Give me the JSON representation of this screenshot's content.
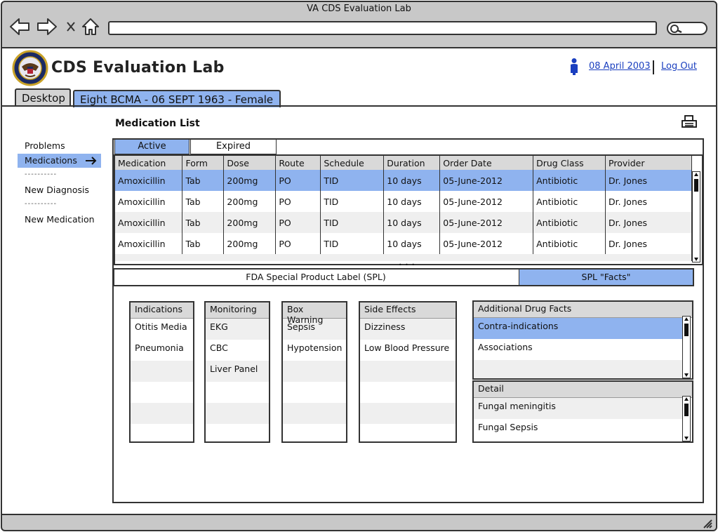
{
  "window": {
    "title": "VA CDS Evaluation Lab"
  },
  "header": {
    "app_name": "CDS Evaluation Lab",
    "date_link": "08 April 2003",
    "logout_label": "Log Out"
  },
  "tabs": [
    {
      "label": "Desktop"
    },
    {
      "label": "Eight BCMA - 06 SEPT 1963 - Female"
    }
  ],
  "sidebar": {
    "items": [
      {
        "label": "Problems"
      },
      {
        "label": "Medications"
      },
      {
        "label": "----------"
      },
      {
        "label": "New Diagnosis"
      },
      {
        "label": "----------"
      },
      {
        "label": "New Medication"
      }
    ]
  },
  "main": {
    "title": "Medication List",
    "subtabs": [
      {
        "label": "Active"
      },
      {
        "label": "Expired"
      }
    ],
    "columns": [
      "Medication",
      "Form",
      "Dose",
      "Route",
      "Schedule",
      "Duration",
      "Order Date",
      "Drug Class",
      "Provider"
    ],
    "rows": [
      [
        "Amoxicillin",
        "Tab",
        "200mg",
        "PO",
        "TID",
        "10 days",
        "05-June-2012",
        "Antibiotic",
        "Dr. Jones"
      ],
      [
        "Amoxicillin",
        "Tab",
        "200mg",
        "PO",
        "TID",
        "10 days",
        "05-June-2012",
        "Antibiotic",
        "Dr. Jones"
      ],
      [
        "Amoxicillin",
        "Tab",
        "200mg",
        "PO",
        "TID",
        "10 days",
        "05-June-2012",
        "Antibiotic",
        "Dr. Jones"
      ],
      [
        "Amoxicillin",
        "Tab",
        "200mg",
        "PO",
        "TID",
        "10 days",
        "05-June-2012",
        "Antibiotic",
        "Dr. Jones"
      ]
    ],
    "splitter": "• • •",
    "spl_tabs": [
      {
        "label": "FDA Special Product Label (SPL)"
      },
      {
        "label": "SPL \"Facts\""
      }
    ]
  },
  "facts": {
    "indications": {
      "header": "Indications",
      "items": [
        "Otitis Media",
        "Pneumonia"
      ]
    },
    "monitoring": {
      "header": "Monitoring",
      "items": [
        "EKG",
        "CBC",
        "Liver Panel"
      ]
    },
    "box_warning": {
      "header": "Box Warning",
      "items": [
        "Sepsis",
        "Hypotension"
      ]
    },
    "side_effects": {
      "header": "Side Effects",
      "items": [
        "Dizziness",
        "Low Blood Pressure"
      ]
    },
    "additional": {
      "header": "Additional Drug Facts",
      "items": [
        "Contra-indications",
        "Associations"
      ]
    },
    "detail": {
      "header": "Detail",
      "items": [
        "Fungal meningitis",
        "Fungal Sepsis"
      ]
    }
  },
  "colors": {
    "selection": "#8fb3ef",
    "chrome": "#c8c8c8",
    "link": "#1a3fbf"
  },
  "icons": {
    "back": "back-arrow-icon",
    "forward": "forward-arrow-icon",
    "stop": "close-icon",
    "home": "home-icon",
    "search": "search-icon",
    "user": "user-icon",
    "print": "printer-icon",
    "arrow": "right-arrow-icon",
    "logo": "va-seal-logo",
    "resize": "resize-grip-icon"
  }
}
